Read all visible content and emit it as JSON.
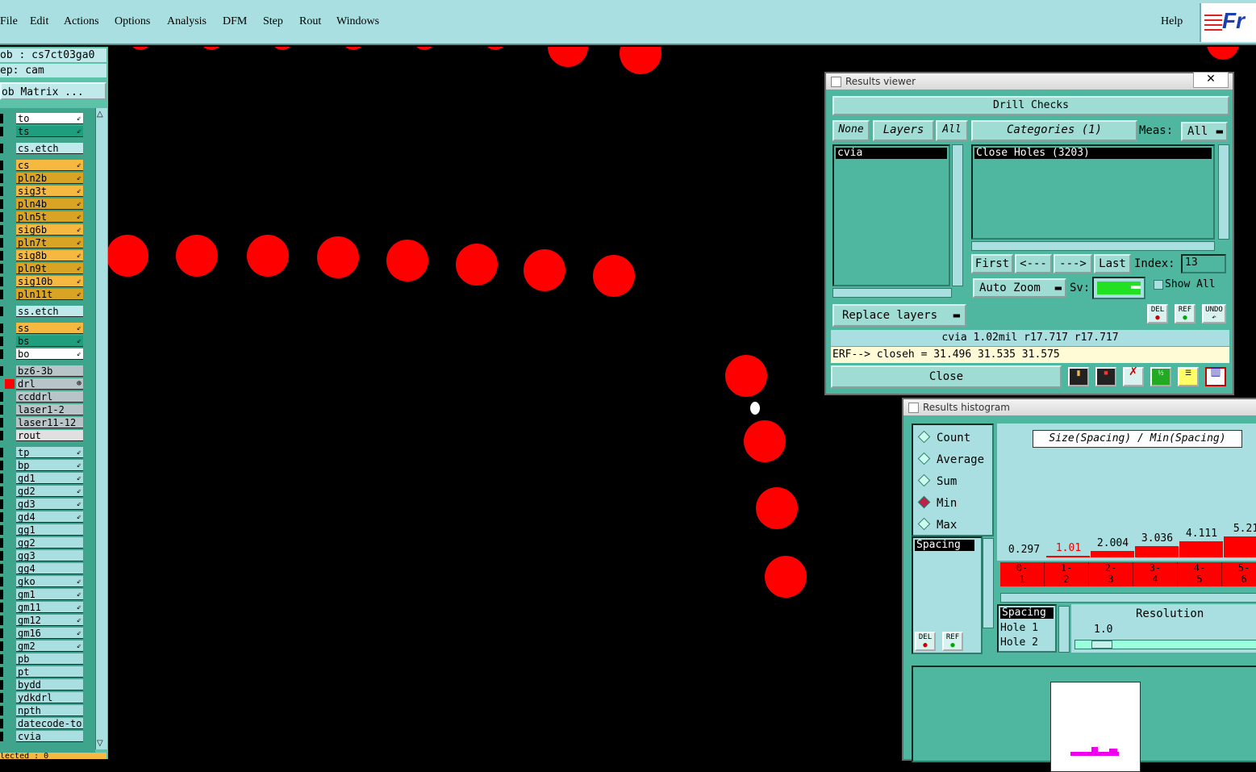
{
  "menu": {
    "items": [
      "File",
      "Edit",
      "Actions",
      "Options",
      "Analysis",
      "DFM",
      "Step",
      "Rout",
      "Windows"
    ],
    "help": "Help",
    "logo": "Fr"
  },
  "job": {
    "job_line": "ob : cs7ct03ga0",
    "step_line": "ep: cam",
    "matrix_button": "ob Matrix ...",
    "bottom_line": "lected : 0"
  },
  "layers": [
    {
      "name": "to",
      "color": "#ffffff",
      "mark": "⇙"
    },
    {
      "name": "ts",
      "color": "#1f9e7e",
      "mark": "⇙"
    },
    {
      "name": "cs.etch",
      "color": "#bfe9ea",
      "mark": ""
    },
    {
      "name": "cs",
      "color": "#f5b942",
      "mark": "⇙"
    },
    {
      "name": "pln2b",
      "color": "#d9a424",
      "mark": "⇙"
    },
    {
      "name": "sig3t",
      "color": "#f5b942",
      "mark": "⇙"
    },
    {
      "name": "pln4b",
      "color": "#d9a424",
      "mark": "⇙"
    },
    {
      "name": "pln5t",
      "color": "#d9a424",
      "mark": "⇙"
    },
    {
      "name": "sig6b",
      "color": "#f5b942",
      "mark": "⇙"
    },
    {
      "name": "pln7t",
      "color": "#d9a424",
      "mark": "⇙"
    },
    {
      "name": "sig8b",
      "color": "#f5b942",
      "mark": "⇙"
    },
    {
      "name": "pln9t",
      "color": "#d9a424",
      "mark": "⇙"
    },
    {
      "name": "sig10b",
      "color": "#f5b942",
      "mark": "⇙"
    },
    {
      "name": "pln11t",
      "color": "#d9a424",
      "mark": "⇙"
    },
    {
      "name": "ss.etch",
      "color": "#bfe9ea",
      "mark": ""
    },
    {
      "name": "ss",
      "color": "#f5b942",
      "mark": "⇙"
    },
    {
      "name": "bs",
      "color": "#1f9e7e",
      "mark": "⇙"
    },
    {
      "name": "bo",
      "color": "#ffffff",
      "mark": "⇙"
    },
    {
      "name": "bz6-3b",
      "color": "#b9c4c9",
      "mark": ""
    },
    {
      "name": "drl",
      "color": "#b9c4c9",
      "mark": "⊕",
      "active": true
    },
    {
      "name": "ccddrl",
      "color": "#b9c4c9",
      "mark": ""
    },
    {
      "name": "laser1-2",
      "color": "#b9c4c9",
      "mark": ""
    },
    {
      "name": "laser11-12",
      "color": "#b9c4c9",
      "mark": ""
    },
    {
      "name": "rout",
      "color": "#e0e0e0",
      "mark": ""
    },
    {
      "name": "tp",
      "color": "#a9dfe0",
      "mark": "⇙"
    },
    {
      "name": "bp",
      "color": "#a9dfe0",
      "mark": "⇙"
    },
    {
      "name": "gd1",
      "color": "#a9dfe0",
      "mark": "⇙"
    },
    {
      "name": "gd2",
      "color": "#a9dfe0",
      "mark": "⇙"
    },
    {
      "name": "gd3",
      "color": "#a9dfe0",
      "mark": "⇙"
    },
    {
      "name": "gd4",
      "color": "#a9dfe0",
      "mark": "⇙"
    },
    {
      "name": "gg1",
      "color": "#a9dfe0",
      "mark": ""
    },
    {
      "name": "gg2",
      "color": "#a9dfe0",
      "mark": ""
    },
    {
      "name": "gg3",
      "color": "#a9dfe0",
      "mark": ""
    },
    {
      "name": "gg4",
      "color": "#a9dfe0",
      "mark": ""
    },
    {
      "name": "gko",
      "color": "#a9dfe0",
      "mark": "⇙"
    },
    {
      "name": "gm1",
      "color": "#a9dfe0",
      "mark": "⇙"
    },
    {
      "name": "gm11",
      "color": "#a9dfe0",
      "mark": "⇙"
    },
    {
      "name": "gm12",
      "color": "#a9dfe0",
      "mark": "⇙"
    },
    {
      "name": "gm16",
      "color": "#a9dfe0",
      "mark": "⇙"
    },
    {
      "name": "gm2",
      "color": "#a9dfe0",
      "mark": "⇙"
    },
    {
      "name": "pb",
      "color": "#a9dfe0",
      "mark": ""
    },
    {
      "name": "pt",
      "color": "#a9dfe0",
      "mark": ""
    },
    {
      "name": "bydd",
      "color": "#a9dfe0",
      "mark": ""
    },
    {
      "name": "ydkdrl",
      "color": "#a9dfe0",
      "mark": ""
    },
    {
      "name": "npth",
      "color": "#a9dfe0",
      "mark": ""
    },
    {
      "name": "datecode-to",
      "color": "#a9dfe0",
      "mark": ""
    },
    {
      "name": "cvia",
      "color": "#a9dfe0",
      "mark": ""
    }
  ],
  "colors": {
    "pad": "#ff0000",
    "highlight": "#ffffff"
  },
  "results_viewer": {
    "title": "Results viewer",
    "close_x": "✕",
    "header": "Drill Checks",
    "none_btn": "None",
    "layers_btn": "Layers",
    "all_btn": "All",
    "categories_btn": "Categories (1)",
    "meas_label": "Meas:",
    "meas_value": "All",
    "layer_item": "cvia",
    "category_item": "Close Holes (3203)",
    "first_btn": "First",
    "prev_btn": "<---",
    "next_btn": "--->",
    "last_btn": "Last",
    "index_label": "Index:",
    "index_value": "13",
    "auto_zoom": "Auto Zoom",
    "sv_label": "Sv:",
    "show_all": "Show All",
    "replace_layers": "Replace layers",
    "del": "DEL",
    "ref": "REF",
    "undo": "UNDO",
    "info_line": "cvia 1.02mil  r17.717  r17.717",
    "erf_line": "ERF--> closeh = 31.496 31.535 31.575",
    "close_btn": "Close"
  },
  "histogram": {
    "title": "Results histogram",
    "radios": [
      {
        "label": "Count",
        "on": false
      },
      {
        "label": "Average",
        "on": false
      },
      {
        "label": "Sum",
        "on": false
      },
      {
        "label": "Min",
        "on": true
      },
      {
        "label": "Max",
        "on": false
      }
    ],
    "list_item": "Spacing",
    "header": "Size(Spacing) / Min(Spacing)",
    "bins": [
      {
        "value": "0.297",
        "range": "0-\n1",
        "level": 0,
        "red": false
      },
      {
        "value": "1.01",
        "range": "1-\n2",
        "level": 0.05,
        "red": true
      },
      {
        "value": "2.004",
        "range": "2-\n3",
        "level": 0.2,
        "red": false
      },
      {
        "value": "3.036",
        "range": "3-\n4",
        "level": 0.35,
        "red": false
      },
      {
        "value": "4.111",
        "range": "4-\n5",
        "level": 0.5,
        "red": false
      },
      {
        "value": "5.21",
        "range": "5-\n6",
        "level": 0.65,
        "red": false
      }
    ],
    "params": [
      "Spacing",
      "Hole 1",
      "Hole 2"
    ],
    "resolution_label": "Resolution",
    "resolution_value": "1.0",
    "del": "DEL",
    "ref": "REF"
  }
}
